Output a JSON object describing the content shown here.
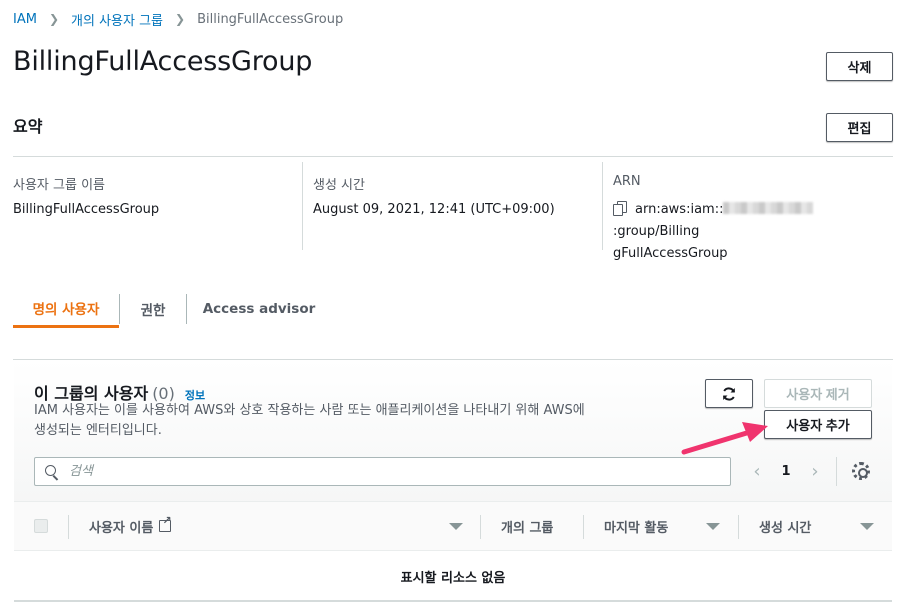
{
  "breadcrumb": {
    "items": [
      "IAM",
      "개의 사용자 그룹",
      "BillingFullAccessGroup"
    ]
  },
  "page": {
    "title": "BillingFullAccessGroup",
    "delete_label": "삭제"
  },
  "summary": {
    "title": "요약",
    "edit_label": "편집",
    "group_name_label": "사용자 그룹 이름",
    "group_name_value": "BillingFullAccessGroup",
    "created_label": "생성 시간",
    "created_value": "August 09, 2021, 12:41 (UTC+09:00)",
    "arn_label": "ARN",
    "arn_prefix": "arn:aws:iam::",
    "arn_suffix": ":group/Billing",
    "arn_line2": "gFullAccessGroup"
  },
  "tabs": [
    {
      "label": "명의 사용자"
    },
    {
      "label": "권한"
    },
    {
      "label": "Access advisor"
    }
  ],
  "users_panel": {
    "title": "이 그룹의 사용자",
    "count": "(0)",
    "info_label": "정보",
    "description": "IAM 사용자는 이를 사용하여 AWS와 상호 작용하는 사람 또는 애플리케이션을 나타내기 위해 AWS에 생성되는 엔터티입니다.",
    "remove_label": "사용자 제거",
    "add_label": "사용자 추가",
    "search_placeholder": "검색",
    "page_number": "1"
  },
  "table": {
    "columns": [
      "사용자 이름",
      "개의 그룹",
      "마지막 활동",
      "생성 시간"
    ],
    "empty_text": "표시할 리소스 없음"
  },
  "colors": {
    "accent": "#ec7211",
    "link": "#0073bb",
    "annotation_arrow": "#f0346e"
  },
  "icons": [
    "refresh-icon",
    "search-icon",
    "settings-icon",
    "copy-icon",
    "external-link-icon",
    "chevron-left-icon",
    "chevron-right-icon",
    "sort-icon"
  ]
}
